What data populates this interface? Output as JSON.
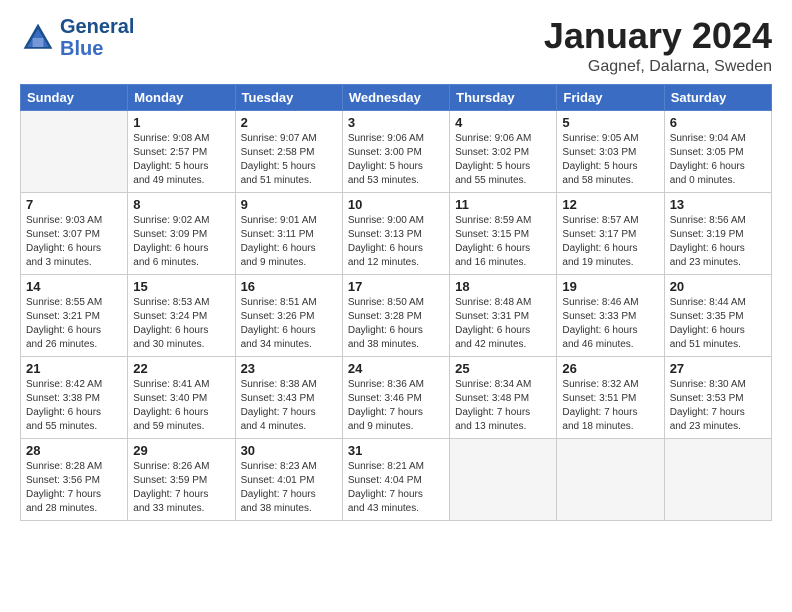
{
  "header": {
    "logo_line1": "General",
    "logo_line2": "Blue",
    "month": "January 2024",
    "location": "Gagnef, Dalarna, Sweden"
  },
  "weekdays": [
    "Sunday",
    "Monday",
    "Tuesday",
    "Wednesday",
    "Thursday",
    "Friday",
    "Saturday"
  ],
  "weeks": [
    [
      {
        "day": "",
        "info": ""
      },
      {
        "day": "1",
        "info": "Sunrise: 9:08 AM\nSunset: 2:57 PM\nDaylight: 5 hours\nand 49 minutes."
      },
      {
        "day": "2",
        "info": "Sunrise: 9:07 AM\nSunset: 2:58 PM\nDaylight: 5 hours\nand 51 minutes."
      },
      {
        "day": "3",
        "info": "Sunrise: 9:06 AM\nSunset: 3:00 PM\nDaylight: 5 hours\nand 53 minutes."
      },
      {
        "day": "4",
        "info": "Sunrise: 9:06 AM\nSunset: 3:02 PM\nDaylight: 5 hours\nand 55 minutes."
      },
      {
        "day": "5",
        "info": "Sunrise: 9:05 AM\nSunset: 3:03 PM\nDaylight: 5 hours\nand 58 minutes."
      },
      {
        "day": "6",
        "info": "Sunrise: 9:04 AM\nSunset: 3:05 PM\nDaylight: 6 hours\nand 0 minutes."
      }
    ],
    [
      {
        "day": "7",
        "info": "Sunrise: 9:03 AM\nSunset: 3:07 PM\nDaylight: 6 hours\nand 3 minutes."
      },
      {
        "day": "8",
        "info": "Sunrise: 9:02 AM\nSunset: 3:09 PM\nDaylight: 6 hours\nand 6 minutes."
      },
      {
        "day": "9",
        "info": "Sunrise: 9:01 AM\nSunset: 3:11 PM\nDaylight: 6 hours\nand 9 minutes."
      },
      {
        "day": "10",
        "info": "Sunrise: 9:00 AM\nSunset: 3:13 PM\nDaylight: 6 hours\nand 12 minutes."
      },
      {
        "day": "11",
        "info": "Sunrise: 8:59 AM\nSunset: 3:15 PM\nDaylight: 6 hours\nand 16 minutes."
      },
      {
        "day": "12",
        "info": "Sunrise: 8:57 AM\nSunset: 3:17 PM\nDaylight: 6 hours\nand 19 minutes."
      },
      {
        "day": "13",
        "info": "Sunrise: 8:56 AM\nSunset: 3:19 PM\nDaylight: 6 hours\nand 23 minutes."
      }
    ],
    [
      {
        "day": "14",
        "info": "Sunrise: 8:55 AM\nSunset: 3:21 PM\nDaylight: 6 hours\nand 26 minutes."
      },
      {
        "day": "15",
        "info": "Sunrise: 8:53 AM\nSunset: 3:24 PM\nDaylight: 6 hours\nand 30 minutes."
      },
      {
        "day": "16",
        "info": "Sunrise: 8:51 AM\nSunset: 3:26 PM\nDaylight: 6 hours\nand 34 minutes."
      },
      {
        "day": "17",
        "info": "Sunrise: 8:50 AM\nSunset: 3:28 PM\nDaylight: 6 hours\nand 38 minutes."
      },
      {
        "day": "18",
        "info": "Sunrise: 8:48 AM\nSunset: 3:31 PM\nDaylight: 6 hours\nand 42 minutes."
      },
      {
        "day": "19",
        "info": "Sunrise: 8:46 AM\nSunset: 3:33 PM\nDaylight: 6 hours\nand 46 minutes."
      },
      {
        "day": "20",
        "info": "Sunrise: 8:44 AM\nSunset: 3:35 PM\nDaylight: 6 hours\nand 51 minutes."
      }
    ],
    [
      {
        "day": "21",
        "info": "Sunrise: 8:42 AM\nSunset: 3:38 PM\nDaylight: 6 hours\nand 55 minutes."
      },
      {
        "day": "22",
        "info": "Sunrise: 8:41 AM\nSunset: 3:40 PM\nDaylight: 6 hours\nand 59 minutes."
      },
      {
        "day": "23",
        "info": "Sunrise: 8:38 AM\nSunset: 3:43 PM\nDaylight: 7 hours\nand 4 minutes."
      },
      {
        "day": "24",
        "info": "Sunrise: 8:36 AM\nSunset: 3:46 PM\nDaylight: 7 hours\nand 9 minutes."
      },
      {
        "day": "25",
        "info": "Sunrise: 8:34 AM\nSunset: 3:48 PM\nDaylight: 7 hours\nand 13 minutes."
      },
      {
        "day": "26",
        "info": "Sunrise: 8:32 AM\nSunset: 3:51 PM\nDaylight: 7 hours\nand 18 minutes."
      },
      {
        "day": "27",
        "info": "Sunrise: 8:30 AM\nSunset: 3:53 PM\nDaylight: 7 hours\nand 23 minutes."
      }
    ],
    [
      {
        "day": "28",
        "info": "Sunrise: 8:28 AM\nSunset: 3:56 PM\nDaylight: 7 hours\nand 28 minutes."
      },
      {
        "day": "29",
        "info": "Sunrise: 8:26 AM\nSunset: 3:59 PM\nDaylight: 7 hours\nand 33 minutes."
      },
      {
        "day": "30",
        "info": "Sunrise: 8:23 AM\nSunset: 4:01 PM\nDaylight: 7 hours\nand 38 minutes."
      },
      {
        "day": "31",
        "info": "Sunrise: 8:21 AM\nSunset: 4:04 PM\nDaylight: 7 hours\nand 43 minutes."
      },
      {
        "day": "",
        "info": ""
      },
      {
        "day": "",
        "info": ""
      },
      {
        "day": "",
        "info": ""
      }
    ]
  ]
}
